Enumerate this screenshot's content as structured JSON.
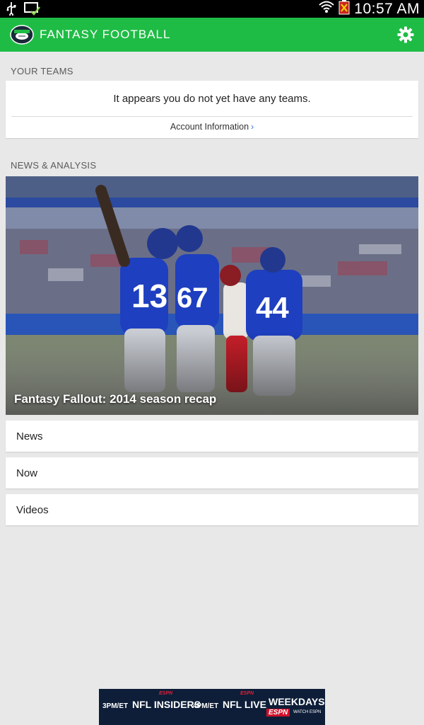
{
  "status_bar": {
    "time": "10:57 AM",
    "icons": [
      "usb-icon",
      "screenshot-check-icon",
      "wifi-icon",
      "battery-icon"
    ]
  },
  "app_bar": {
    "title": "FANTASY FOOTBALL",
    "logo_text": "FANTASY",
    "color": "#1fbc45",
    "settings_icon": "gear-icon"
  },
  "your_teams": {
    "header": "YOUR TEAMS",
    "empty_message": "It appears you do not yet have any teams.",
    "link_label": "Account Information",
    "link_chevron": "›"
  },
  "news_analysis": {
    "header": "NEWS & ANALYSIS",
    "hero_caption": "Fantasy Fallout: 2014 season recap",
    "items": [
      {
        "label": "News"
      },
      {
        "label": "Now"
      },
      {
        "label": "Videos"
      }
    ]
  },
  "ad_banner": {
    "segments": [
      {
        "time": "3PM/ET",
        "show": "NFL INSIDERS",
        "network": "ESPN"
      },
      {
        "time": "4PM/ET",
        "show": "NFL LIVE",
        "network": "ESPN"
      }
    ],
    "cta": "WEEKDAYS",
    "espn": "ESPN",
    "watch": "WATCH ESPN"
  }
}
